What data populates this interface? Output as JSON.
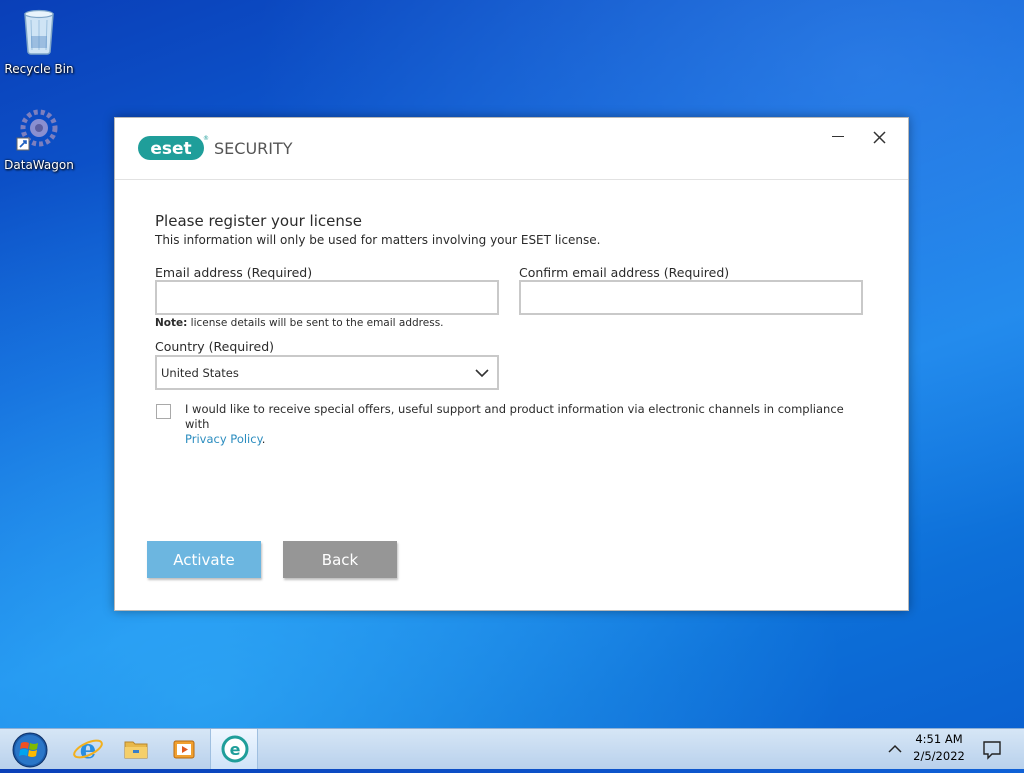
{
  "desktop": {
    "icons": [
      {
        "label": "Recycle Bin",
        "icon": "recycle-bin-icon"
      },
      {
        "label": "DataWagon",
        "icon": "datawagon-shortcut-icon"
      }
    ]
  },
  "dialog": {
    "brand": {
      "logo_text": "eset",
      "product": "SECURITY"
    },
    "heading": "Please register your license",
    "subheading": "This information will only be used for matters involving your ESET license.",
    "email": {
      "label": "Email address (Required)",
      "value": "",
      "placeholder": ""
    },
    "confirm_email": {
      "label": "Confirm email address (Required)",
      "value": "",
      "placeholder": ""
    },
    "note": {
      "bold": "Note:",
      "text": " license details will be sent to the email address."
    },
    "country": {
      "label": "Country (Required)",
      "selected": "United States"
    },
    "consent": {
      "checked": false,
      "text": "I would like to receive special offers, useful support and product information via electronic channels in compliance with",
      "link": "Privacy Policy",
      "suffix": "."
    },
    "buttons": {
      "activate": "Activate",
      "back": "Back"
    },
    "colors": {
      "accent": "#6cb6e0",
      "brand_teal": "#1f9e9a",
      "link": "#2a8cbf",
      "back_button": "#969696"
    }
  },
  "taskbar": {
    "items": [
      "start-orb-icon",
      "internet-explorer-icon",
      "file-explorer-icon",
      "media-player-icon",
      "eset-taskbar-icon"
    ],
    "clock": {
      "time": "4:51 AM",
      "date": "2/5/2022"
    }
  }
}
